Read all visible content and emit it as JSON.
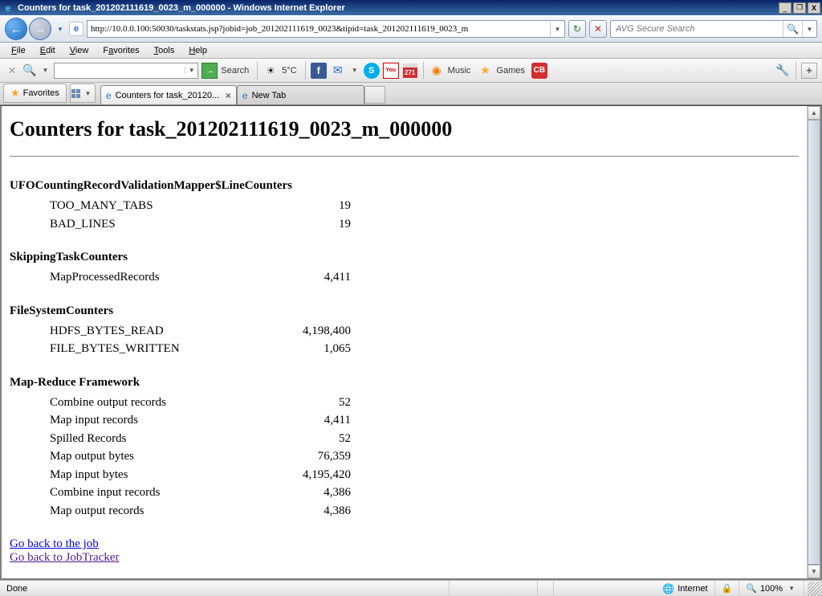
{
  "titlebar": {
    "title": "Counters for task_201202111619_0023_m_000000 - Windows Internet Explorer"
  },
  "nav": {
    "url": "http://10.0.0.100:50030/taskstats.jsp?jobid=job_201202111619_0023&tipid=task_201202111619_0023_m",
    "search_placeholder": "AVG Secure Search"
  },
  "menu": {
    "file": "File",
    "edit": "Edit",
    "view": "View",
    "favorites": "Favorites",
    "tools": "Tools",
    "help": "Help"
  },
  "toolbar": {
    "search_label": "Search",
    "weather": "5°C",
    "cal_badge": "271",
    "music": "Music",
    "games": "Games"
  },
  "tabs": {
    "favorites": "Favorites",
    "tab1": "Counters for task_20120...",
    "tab2": "New Tab"
  },
  "page": {
    "heading": "Counters for task_201202111619_0023_m_000000",
    "groups": [
      {
        "title": "UFOCountingRecordValidationMapper$LineCounters",
        "rows": [
          {
            "name": "TOO_MANY_TABS",
            "value": "19"
          },
          {
            "name": "BAD_LINES",
            "value": "19"
          }
        ]
      },
      {
        "title": "SkippingTaskCounters",
        "rows": [
          {
            "name": "MapProcessedRecords",
            "value": "4,411"
          }
        ]
      },
      {
        "title": "FileSystemCounters",
        "rows": [
          {
            "name": "HDFS_BYTES_READ",
            "value": "4,198,400"
          },
          {
            "name": "FILE_BYTES_WRITTEN",
            "value": "1,065"
          }
        ]
      },
      {
        "title": "Map-Reduce Framework",
        "rows": [
          {
            "name": "Combine output records",
            "value": "52"
          },
          {
            "name": "Map input records",
            "value": "4,411"
          },
          {
            "name": "Spilled Records",
            "value": "52"
          },
          {
            "name": "Map output bytes",
            "value": "76,359"
          },
          {
            "name": "Map input bytes",
            "value": "4,195,420"
          },
          {
            "name": "Combine input records",
            "value": "4,386"
          },
          {
            "name": "Map output records",
            "value": "4,386"
          }
        ]
      }
    ],
    "link_job": "Go back to the job",
    "link_tracker": "Go back to JobTracker"
  },
  "status": {
    "done": "Done",
    "zone": "Internet",
    "zoom": "100%"
  }
}
